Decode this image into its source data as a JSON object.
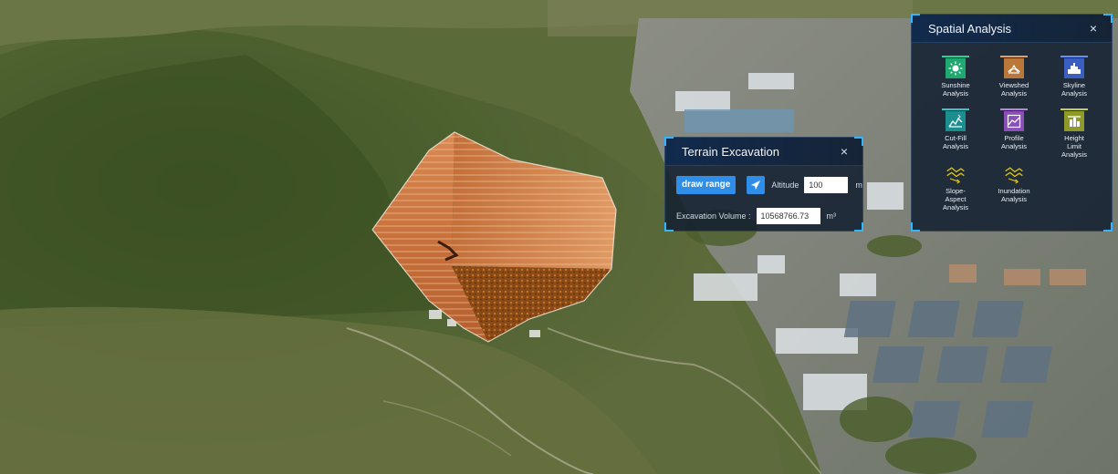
{
  "excavation_panel": {
    "title": "Terrain Excavation",
    "close_label": "×",
    "draw_range_label": "draw range",
    "altitude_label": "Altitude",
    "altitude_value": "100",
    "altitude_unit": "m",
    "volume_label": "Excavation Volume :",
    "volume_value": "10568766.73",
    "volume_unit": "m³"
  },
  "spatial_panel": {
    "title": "Spatial Analysis",
    "close_label": "×",
    "tools": [
      {
        "line1": "Sunshine",
        "line2": "Analysis",
        "line3": "",
        "icon": "sun-icon",
        "color": "#1fa86f"
      },
      {
        "line1": "Viewshed",
        "line2": "Analysis",
        "line3": "",
        "icon": "viewshed-icon",
        "color": "#b9773a"
      },
      {
        "line1": "Skyline",
        "line2": "Analysis",
        "line3": "",
        "icon": "skyline-icon",
        "color": "#3a5fc0"
      },
      {
        "line1": "Cut-Fill",
        "line2": "Analysis",
        "line3": "",
        "icon": "cut-fill-icon",
        "color": "#1b8f8f"
      },
      {
        "line1": "Profile",
        "line2": "Analysis",
        "line3": "",
        "icon": "profile-icon",
        "color": "#8a4fb8"
      },
      {
        "line1": "Height",
        "line2": "Limit",
        "line3": "Analysis",
        "icon": "height-limit-icon",
        "color": "#8e9a2a"
      },
      {
        "line1": "Slope-",
        "line2": "Aspect",
        "line3": "Analysis",
        "icon": "slope-aspect-icon",
        "color": "#d7c21a"
      },
      {
        "line1": "Inundation",
        "line2": "Analysis",
        "line3": "",
        "icon": "inundation-icon",
        "color": "#d7c21a"
      }
    ]
  },
  "colors": {
    "accent": "#2f8fe8",
    "panel_bg": "#121e30",
    "corner": "#2fb6ff"
  }
}
